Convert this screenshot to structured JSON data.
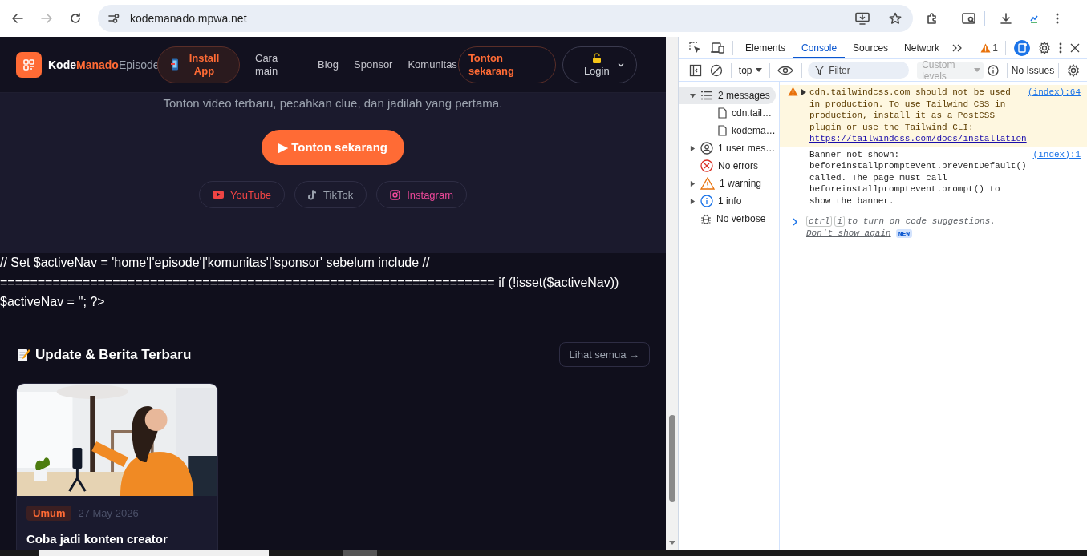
{
  "browser": {
    "url": "kodemanado.mpwa.net",
    "forward": {
      "disabled": true
    }
  },
  "site": {
    "brand": {
      "first": "Kode",
      "second": "Manado",
      "third": "Episode"
    },
    "nav": [
      {
        "kind": "install",
        "label": "Install App"
      },
      {
        "kind": "link",
        "label": "Cara main"
      },
      {
        "kind": "link",
        "label": "Blog"
      },
      {
        "kind": "link",
        "label": "Sponsor"
      },
      {
        "kind": "link",
        "label": "Komunitas"
      },
      {
        "kind": "cta",
        "label": "Tonton sekarang"
      }
    ],
    "login": {
      "label": "Login"
    },
    "hero": {
      "subtitle": "Tonton video terbaru, pecahkan clue, dan jadilah yang pertama.",
      "cta": "▶ Tonton sekarang",
      "socials": [
        {
          "kind": "youtube",
          "label": "YouTube",
          "color": "#ef4444"
        },
        {
          "kind": "tiktok",
          "label": "TikTok",
          "color": "#9ca3af"
        },
        {
          "kind": "instagram",
          "label": "Instagram",
          "color": "#ec4899"
        }
      ]
    },
    "code_text": "// Set $activeNav = 'home'|'episode'|'komunitas'|'sponsor' sebelum include // ================================================================== if (!isset($activeNav)) $activeNav = ''; ?>",
    "news": {
      "title": "Update & Berita Terbaru",
      "see_all": "Lihat semua →",
      "cards": [
        {
          "tag": "Umum",
          "date": "27 May 2026",
          "title": "Coba jadi konten creator"
        }
      ]
    }
  },
  "devtools": {
    "tabs": [
      {
        "label": "Elements",
        "selected": false
      },
      {
        "label": "Console",
        "selected": true
      },
      {
        "label": "Sources",
        "selected": false
      },
      {
        "label": "Network",
        "selected": false
      }
    ],
    "warning_count": "1",
    "context": "top",
    "filter": {
      "placeholder": "Filter"
    },
    "levels": {
      "label": "Custom levels",
      "disabled": true
    },
    "issues": "No Issues",
    "sidebar": [
      {
        "kind": "messages",
        "label": "2 messages",
        "expanded": true,
        "selected": true,
        "children": [
          {
            "kind": "file",
            "label": "cdn.tail…",
            "selected": false
          },
          {
            "kind": "file",
            "label": "kodema…",
            "selected": false
          }
        ]
      },
      {
        "kind": "user",
        "label": "1 user mes…",
        "expanded": false,
        "selected": false
      },
      {
        "kind": "error",
        "label": "No errors",
        "selected": false
      },
      {
        "kind": "warning",
        "label": "1 warning",
        "expanded": false,
        "selected": false
      },
      {
        "kind": "info",
        "label": "1 info",
        "expanded": false,
        "selected": false
      },
      {
        "kind": "verbose",
        "label": "No verbose",
        "selected": false
      }
    ],
    "messages": [
      {
        "kind": "warning",
        "text": "cdn.tailwindcss.com should not be used in production. To use Tailwind CSS in production, install it as a PostCSS plugin or use the Tailwind CLI:",
        "link": "https://tailwindcss.com/docs/installation",
        "source": "(index):64"
      },
      {
        "kind": "info",
        "text": "Banner not shown: beforeinstallpromptevent.preventDefault() called. The page must call beforeinstallpromptevent.prompt() to show the banner.",
        "source": "(index):1"
      }
    ],
    "prompt": {
      "keys": [
        "ctrl",
        "i"
      ],
      "text": "to turn on code suggestions.",
      "link": "Don't show again",
      "badge": "NEW"
    }
  }
}
